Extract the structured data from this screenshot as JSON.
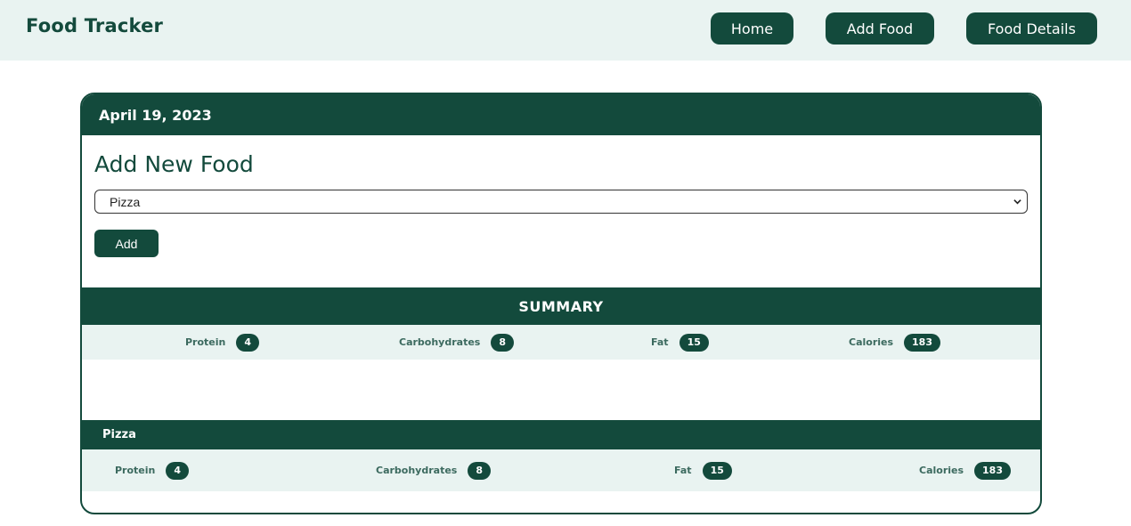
{
  "navbar": {
    "brand": "Food Tracker",
    "links": [
      "Home",
      "Add Food",
      "Food Details"
    ]
  },
  "card": {
    "date": "April 19, 2023",
    "form": {
      "title": "Add New Food",
      "selected_food": "Pizza",
      "add_label": "Add"
    },
    "summary": {
      "title": "SUMMARY",
      "stats": [
        {
          "label": "Protein",
          "value": "4"
        },
        {
          "label": "Carbohydrates",
          "value": "8"
        },
        {
          "label": "Fat",
          "value": "15"
        },
        {
          "label": "Calories",
          "value": "183"
        }
      ]
    },
    "items": [
      {
        "name": "Pizza",
        "stats": [
          {
            "label": "Protein",
            "value": "4"
          },
          {
            "label": "Carbohydrates",
            "value": "8"
          },
          {
            "label": "Fat",
            "value": "15"
          },
          {
            "label": "Calories",
            "value": "183"
          }
        ]
      }
    ]
  },
  "colors": {
    "primary": "#134a3c",
    "light_bg": "#e9f3f1",
    "label_text": "#3c6a5f"
  }
}
